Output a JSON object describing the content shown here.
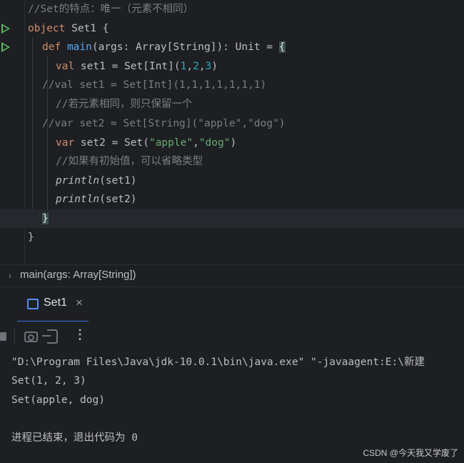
{
  "editor": {
    "lines": [
      {
        "segments": [
          {
            "t": "//Set的特点：唯一（元素不相同）",
            "c": "cm"
          }
        ]
      },
      {
        "segments": [
          {
            "t": "object",
            "c": "kw"
          },
          {
            "t": " Set1 {",
            "c": ""
          }
        ]
      },
      {
        "segments": [
          {
            "t": "def",
            "c": "kw"
          },
          {
            "t": " ",
            "c": ""
          },
          {
            "t": "main",
            "c": "fn"
          },
          {
            "t": "(args: Array[String]): Unit = ",
            "c": ""
          },
          {
            "t": "{",
            "c": "brace-hl"
          }
        ]
      },
      {
        "segments": [
          {
            "t": "val",
            "c": "kw"
          },
          {
            "t": " set1 = Set[Int](",
            "c": ""
          },
          {
            "t": "1",
            "c": "num"
          },
          {
            "t": ",",
            "c": ""
          },
          {
            "t": "2",
            "c": "num"
          },
          {
            "t": ",",
            "c": ""
          },
          {
            "t": "3",
            "c": "num"
          },
          {
            "t": ")",
            "c": ""
          }
        ]
      },
      {
        "segments": [
          {
            "t": "//val set1 = Set[Int](1,1,1,1,1,1,1)",
            "c": "cm"
          }
        ]
      },
      {
        "segments": [
          {
            "t": "//若元素相同，则只保留一个",
            "c": "cm"
          }
        ]
      },
      {
        "segments": [
          {
            "t": "//var set2 = Set[String](\"apple\",\"dog\")",
            "c": "cm"
          }
        ]
      },
      {
        "segments": [
          {
            "t": "var",
            "c": "kw"
          },
          {
            "t": " set2 = Set(",
            "c": ""
          },
          {
            "t": "\"apple\"",
            "c": "str"
          },
          {
            "t": ",",
            "c": ""
          },
          {
            "t": "\"dog\"",
            "c": "str"
          },
          {
            "t": ")",
            "c": ""
          }
        ]
      },
      {
        "segments": [
          {
            "t": "//如果有初始值，可以省略类型",
            "c": "cm"
          }
        ]
      },
      {
        "segments": [
          {
            "t": "println",
            "c": "it"
          },
          {
            "t": "(set1)",
            "c": ""
          }
        ]
      },
      {
        "segments": [
          {
            "t": "println",
            "c": "it"
          },
          {
            "t": "(set2)",
            "c": ""
          }
        ]
      },
      {
        "segments": [
          {
            "t": "}",
            "c": "brace-hl"
          }
        ]
      },
      {
        "segments": [
          {
            "t": "}",
            "c": ""
          }
        ]
      }
    ]
  },
  "breadcrumb": {
    "text": "main(args: Array[String])"
  },
  "run_panel": {
    "tab_label": "Set1",
    "close_glyph": "×",
    "more_glyph": "⋮",
    "console_lines": [
      "\"D:\\Program Files\\Java\\jdk-10.0.1\\bin\\java.exe\" \"-javaagent:E:\\新建",
      "Set(1, 2, 3)",
      "Set(apple, dog)",
      "",
      "进程已结束，退出代码为 0"
    ]
  },
  "watermark": "CSDN @今天我又学废了",
  "colors": {
    "keyword": "#cf8e6d",
    "function": "#56a8f5",
    "number": "#2aacb8",
    "string": "#6aab73",
    "comment": "#7a7e85",
    "accent": "#3574f0",
    "run": "#5fb865"
  }
}
